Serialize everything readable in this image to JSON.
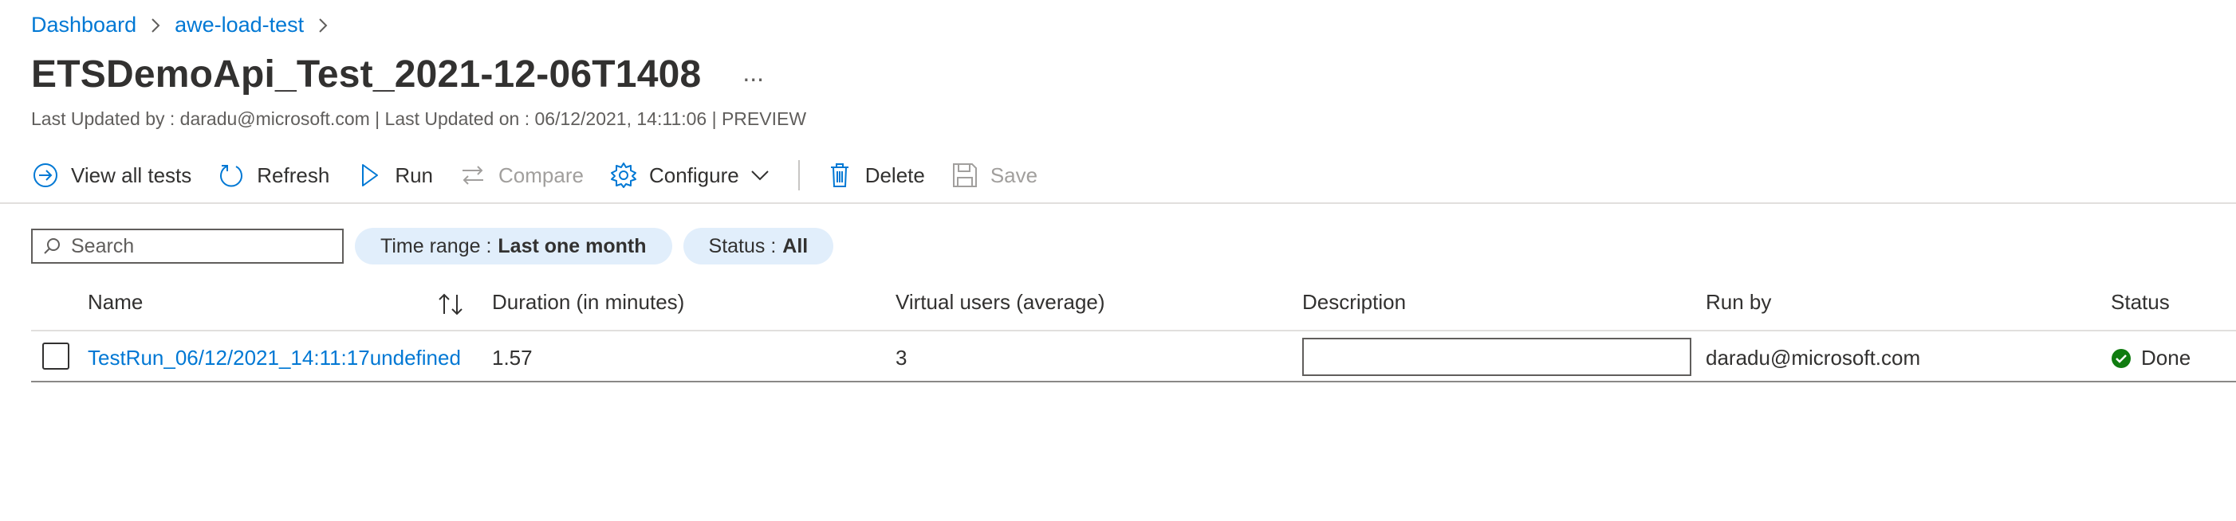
{
  "breadcrumb": [
    {
      "label": "Dashboard"
    },
    {
      "label": "awe-load-test"
    }
  ],
  "page": {
    "title": "ETSDemoApi_Test_2021-12-06T1408",
    "more_label": "...",
    "subtitle": "Last Updated by : daradu@microsoft.com | Last Updated on : 06/12/2021, 14:11:06 | PREVIEW"
  },
  "toolbar": {
    "view_all_tests": "View all tests",
    "refresh": "Refresh",
    "run": "Run",
    "compare": "Compare",
    "configure": "Configure",
    "delete": "Delete",
    "save": "Save"
  },
  "filters": {
    "search_placeholder": "Search",
    "search_value": "",
    "time_range_label": "Time range :",
    "time_range_value": "Last one month",
    "status_label": "Status :",
    "status_value": "All"
  },
  "table": {
    "columns": {
      "name": "Name",
      "duration": "Duration (in minutes)",
      "virtual_users": "Virtual users (average)",
      "description": "Description",
      "run_by": "Run by",
      "status": "Status"
    },
    "rows": [
      {
        "name": "TestRun_06/12/2021_14:11:17undefined",
        "duration": "1.57",
        "virtual_users": "3",
        "description": "",
        "run_by": "daradu@microsoft.com",
        "status": "Done",
        "checked": false
      }
    ]
  },
  "colors": {
    "accent": "#0078d4",
    "pill_bg": "#e1eefb",
    "status_done": "#107c10",
    "text": "#323130",
    "disabled": "#a19f9d"
  },
  "icons": {
    "breadcrumb_separator": "chevron-right-icon",
    "view_all_tests": "arrow-circle-icon",
    "refresh": "refresh-icon",
    "run": "play-icon",
    "compare": "compare-arrows-icon",
    "configure": "gear-icon",
    "delete": "trash-icon",
    "save": "save-icon",
    "search": "search-icon",
    "sort": "sort-icon",
    "status_done": "check-circle-icon"
  }
}
